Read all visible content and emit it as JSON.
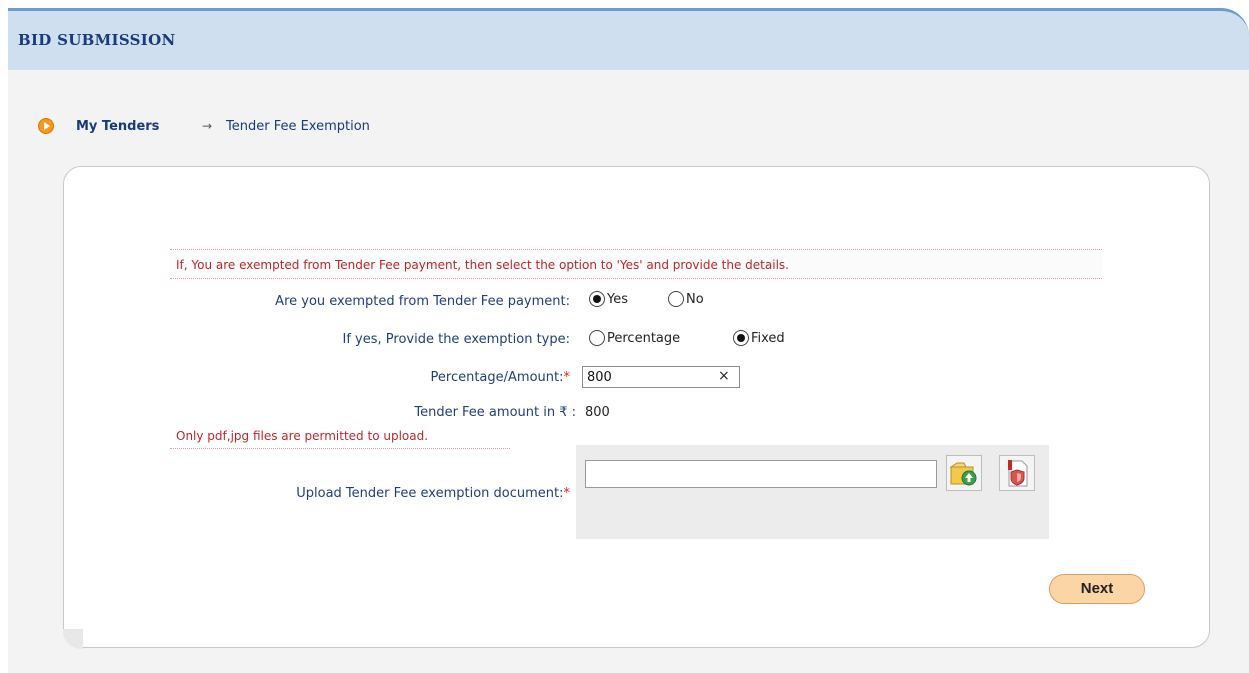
{
  "header": {
    "title": "BID SUBMISSION"
  },
  "breadcrumb": {
    "home": "My Tenders",
    "separator": "→",
    "current": "Tender Fee Exemption"
  },
  "form": {
    "notice": "If, You are exempted from Tender Fee payment, then select the option to 'Yes' and provide the details.",
    "exempted_label": "Are you exempted from Tender Fee payment:",
    "exempted_yes": "Yes",
    "exempted_no": "No",
    "exempted_selected": "Yes",
    "type_label": "If yes, Provide the exemption type:",
    "type_percentage": "Percentage",
    "type_fixed": "Fixed",
    "type_selected": "Fixed",
    "amount_label": "Percentage/Amount:",
    "amount_value": "800",
    "clear_icon": "×",
    "fee_label": "Tender Fee amount in ₹ :",
    "fee_value": "800",
    "upload_notice": "Only pdf,jpg files are permitted to upload.",
    "upload_label": "Upload Tender Fee exemption document:",
    "required_mark": "*",
    "upload_icon": "folder-upload-icon",
    "pdf_icon": "pdf-document-icon"
  },
  "actions": {
    "next_label": "Next"
  },
  "colors": {
    "header_bg": "#cfdff0",
    "accent": "#f29a1a",
    "link": "#173c7b",
    "error": "#b8282b"
  }
}
